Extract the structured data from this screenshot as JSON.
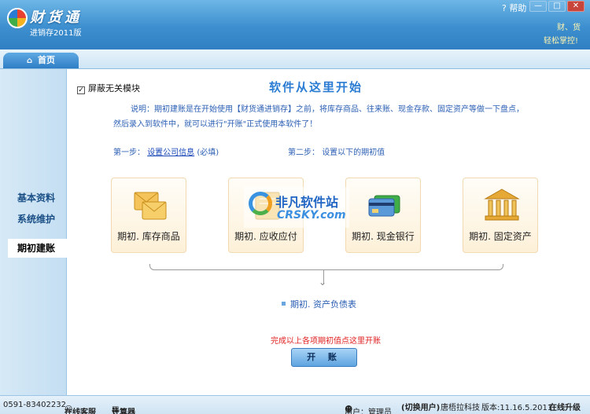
{
  "app": {
    "name": "财货通",
    "subtitle": "进销存2011版",
    "help": "帮助",
    "win_min": "—",
    "win_max": "□",
    "win_close": "✕",
    "slogan_line1": "财、货",
    "slogan_line2": "轻松掌控!"
  },
  "tabs": {
    "home": "首页"
  },
  "sidebar": {
    "items": [
      {
        "label": "基本资料"
      },
      {
        "label": "系统维护"
      },
      {
        "label": "期初建账"
      }
    ]
  },
  "main": {
    "checkbox_mark": "✓",
    "checkbox_label": "屏蔽无关模块",
    "heading": "软件从这里开始",
    "desc_line1": "说明：期初建账是在开始使用【财货通进销存】之前，将库存商品、往来账、现金存款、固定资产等做一下盘点，",
    "desc_line2": "然后录入到软件中，就可以进行\"开账\"正式使用本软件了！",
    "step1_label": "第一步：",
    "step1_link": "设置公司信息",
    "step1_note": "(必填)",
    "step2_label": "第二步：",
    "step2_text": "设置以下的期初值",
    "cards": [
      {
        "label": "期初. 库存商品",
        "icon": "envelopes-icon"
      },
      {
        "label": "期初. 应收应付",
        "icon": "ledger-icon"
      },
      {
        "label": "期初. 现金银行",
        "icon": "bank-cards-icon"
      },
      {
        "label": "期初. 固定资产",
        "icon": "building-icon"
      }
    ],
    "balance_sheet": "期初. 资产负债表",
    "finish_note": "完成以上各项期初值点这里开账",
    "open_button": "开 账"
  },
  "watermark": {
    "line1": "非凡软件站",
    "line2": "CRSKY.com"
  },
  "status": {
    "phone": "0591-83402232",
    "online_service": "在线客服",
    "calculator": "计算器",
    "user": "用户：管理员",
    "switch_user": "(切换用户)",
    "company": "唐梧拉科技",
    "version": "版本:11.16.5.2011",
    "upgrade": "在线升级"
  },
  "colors": {
    "accent": "#2f7fc2",
    "link": "#2b5fb4",
    "warning": "#e02020"
  }
}
